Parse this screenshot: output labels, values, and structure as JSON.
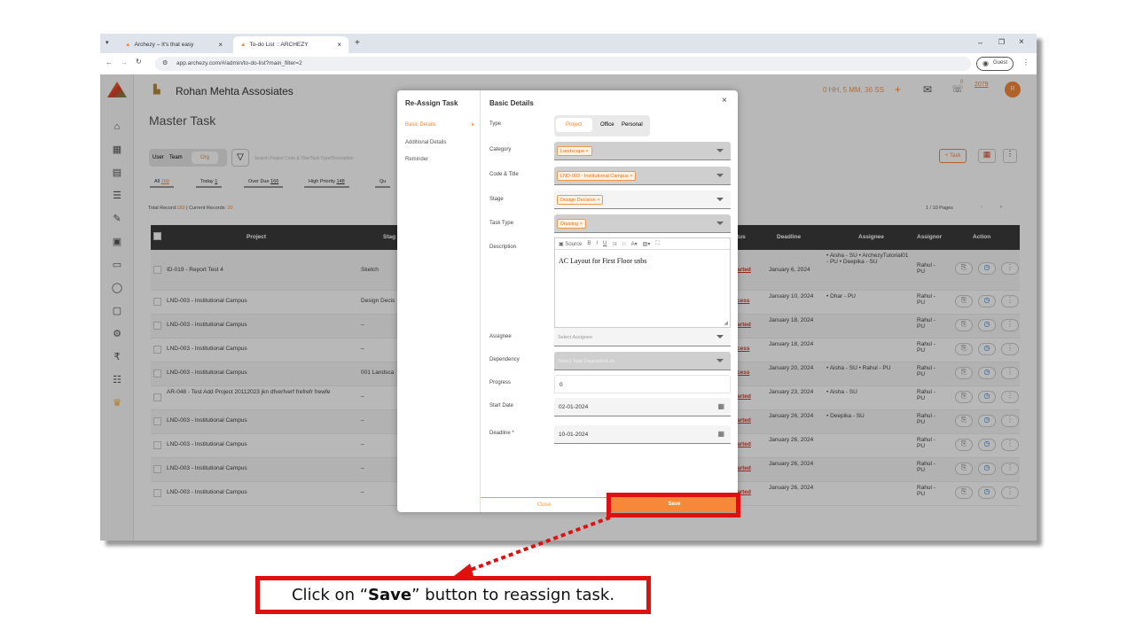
{
  "browser": {
    "tabs": [
      {
        "label": "Archezy – It's that easy"
      },
      {
        "label": "To-do List :: ARCHEZY"
      }
    ],
    "url": "app.archezy.com/#/admin/to-do-list?main_filter=2",
    "guest_label": "Guest"
  },
  "app": {
    "company": "Rohan Mehta Assosiates",
    "page_title": "Master Task",
    "timer": "0 HH, 5 MM, 36 SS",
    "notif_count": "0",
    "year_count": "2079",
    "avatar_initial": "R",
    "scope_tabs": [
      "User",
      "Team",
      "Org"
    ],
    "search_placeholder": "Search Project Code & Title/Task Type/Description",
    "filters": [
      {
        "label": "All",
        "count": "169"
      },
      {
        "label": "Today",
        "count": "1"
      },
      {
        "label": "Over Due",
        "count": "166"
      },
      {
        "label": "High Priority",
        "count": "148"
      },
      {
        "label": "Qu",
        "count": ""
      }
    ],
    "record_summary_prefix": "Total Record:",
    "record_total": "183",
    "record_current_prefix": "| Current Records:",
    "record_current": "20",
    "pages": "1 / 10 Pages",
    "add_task_label": "+ Task",
    "columns": [
      "Project",
      "Stag",
      "tus",
      "Deadline",
      "Assignee",
      "Assignor",
      "Action"
    ],
    "rows": [
      {
        "project": "ID-019 - Report Test 4",
        "stage": "Sketch",
        "status": "arted",
        "deadline": "January 6, 2024",
        "assignee": "• Aisha - SU • ArchezyTutorial01 - PU • Deepika - SU",
        "assignor": "Rahul - PU"
      },
      {
        "project": "LND-003 - Institutional Campus",
        "stage": "Design Decis",
        "status": "cess",
        "deadline": "January 10, 2024",
        "assignee": "• Dhar - PU",
        "assignor": "Rahul - PU"
      },
      {
        "project": "LND-003 - Institutional Campus",
        "stage": "–",
        "status": "arted",
        "deadline": "January 18, 2024",
        "assignee": "",
        "assignor": "Rahul - PU"
      },
      {
        "project": "LND-003 - Institutional Campus",
        "stage": "–",
        "status": "cess",
        "deadline": "January 18, 2024",
        "assignee": "",
        "assignor": "Rahul - PU"
      },
      {
        "project": "LND-003 - Institutional Campus",
        "stage": "001 Landsca",
        "status": "cess",
        "deadline": "January 20, 2024",
        "assignee": "• Aisha - SU • Rahul - PU",
        "assignor": "Rahul - PU"
      },
      {
        "project": "AR-048 - Test Add Project 20112023 jkn dfverfverf frefrefr frewfe",
        "stage": "–",
        "status": "arted",
        "deadline": "January 23, 2024",
        "assignee": "• Aisha - SU",
        "assignor": "Rahul - PU"
      },
      {
        "project": "LND-003 - Institutional Campus",
        "stage": "–",
        "status": "arted",
        "deadline": "January 26, 2024",
        "assignee": "• Deepika - SU",
        "assignor": "Rahul - PU"
      },
      {
        "project": "LND-003 - Institutional Campus",
        "stage": "–",
        "status": "arted",
        "deadline": "January 26, 2024",
        "assignee": "",
        "assignor": "Rahul - PU"
      },
      {
        "project": "LND-003 - Institutional Campus",
        "stage": "–",
        "status": "arted",
        "deadline": "January 26, 2024",
        "assignee": "",
        "assignor": "Rahul - PU"
      },
      {
        "project": "LND-003 - Institutional Campus",
        "stage": "–",
        "status": "arted",
        "deadline": "January 26, 2024",
        "assignee": "",
        "assignor": "Rahul - PU"
      }
    ]
  },
  "modal": {
    "title": "Re-Assign Task",
    "nav": [
      "Basic Details",
      "Additional Details",
      "Reminder"
    ],
    "section_title": "Basic Details",
    "type_label": "Type",
    "type_options": [
      "Project",
      "Office",
      "Personal"
    ],
    "category_label": "Category",
    "category_value": "Landscape ×",
    "code_label": "Code & Title",
    "code_value": "LND-003 - Institutional Campus ×",
    "stage_label": "Stage",
    "stage_value": "Design Decision ×",
    "task_type_label": "Task Type",
    "task_type_value": "Drawing ×",
    "description_label": "Description",
    "description_text": "AC Layout for First Floor snbs",
    "source_label": "Source",
    "assignee_label": "Assignee",
    "assignee_placeholder": "Select Assignee",
    "dependency_label": "Dependency",
    "dependency_placeholder": "Select Task Dependent on",
    "progress_label": "Progress",
    "progress_value": "0",
    "start_label": "Start Date",
    "start_value": "02-01-2024",
    "deadline_label": "Deadline *",
    "deadline_value": "10-01-2024",
    "close_label": "Close",
    "save_label": "Save"
  },
  "annotation": {
    "pre": "Click on “",
    "bold": "Save",
    "post": "” button to reassign task."
  },
  "colors": {
    "accent": "#f7883a",
    "callout": "#e01010"
  }
}
